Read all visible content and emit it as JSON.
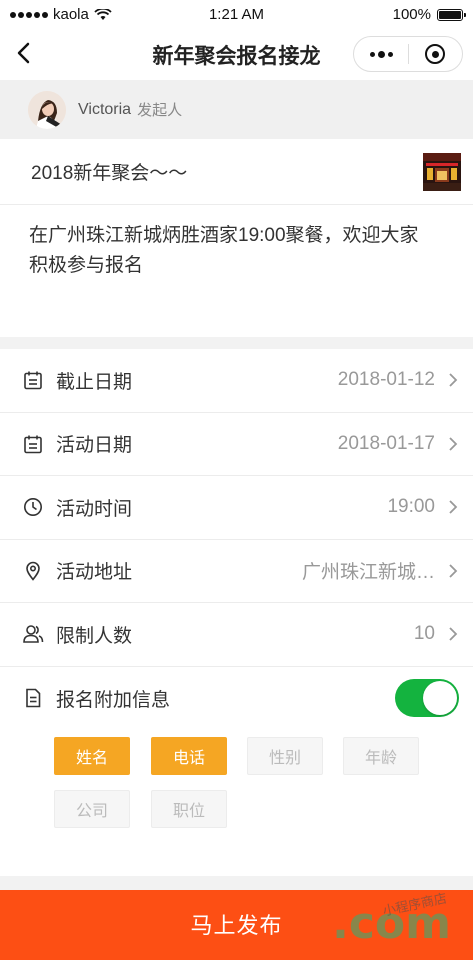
{
  "status_bar": {
    "carrier": "kaola",
    "time": "1:21 AM",
    "battery": "100%"
  },
  "nav": {
    "title": "新年聚会报名接龙"
  },
  "initiator": {
    "name": "Victoria",
    "role": "发起人"
  },
  "event": {
    "title": "2018新年聚会～～",
    "description": "在广州珠江新城炳胜酒家19:00聚餐，欢迎大家积极参与报名"
  },
  "fields": [
    {
      "label": "截止日期",
      "value": "2018-01-12",
      "icon": "calendar-icon"
    },
    {
      "label": "活动日期",
      "value": "2018-01-17",
      "icon": "calendar-icon"
    },
    {
      "label": "活动时间",
      "value": "19:00",
      "icon": "clock-icon"
    },
    {
      "label": "活动地址",
      "value": "广州珠江新城…",
      "icon": "location-pin-icon"
    },
    {
      "label": "限制人数",
      "value": "10",
      "icon": "people-icon"
    }
  ],
  "extra_info": {
    "label": "报名附加信息",
    "enabled": true,
    "chips": [
      {
        "label": "姓名",
        "selected": true
      },
      {
        "label": "电话",
        "selected": true
      },
      {
        "label": "性别",
        "selected": false
      },
      {
        "label": "年龄",
        "selected": false
      },
      {
        "label": "公司",
        "selected": false
      },
      {
        "label": "职位",
        "selected": false
      }
    ]
  },
  "publish": {
    "label": "马上发布"
  },
  "watermark": {
    "text": ".com",
    "script": "小程序商店"
  },
  "colors": {
    "accent_orange": "#f5a623",
    "publish_red": "#fd4f14",
    "toggle_green": "#14b33f"
  }
}
